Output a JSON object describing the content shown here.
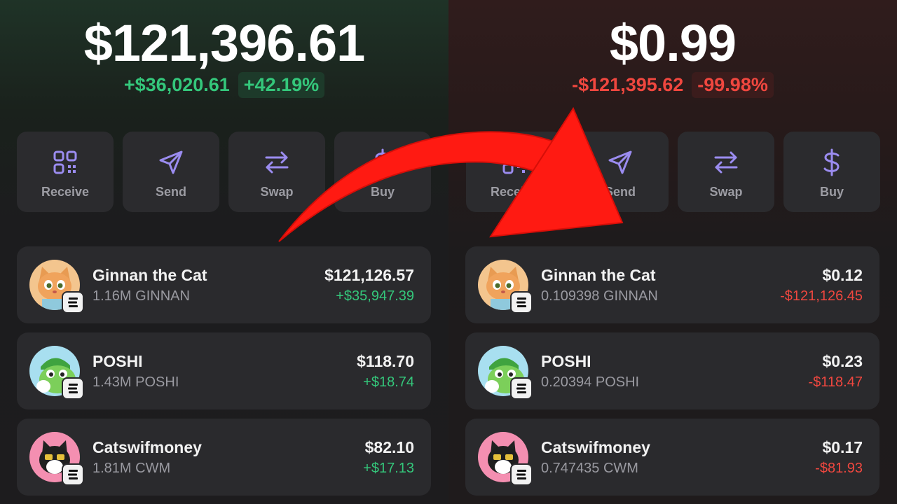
{
  "left": {
    "balance": "$121,396.61",
    "change_amount": "+$36,020.61",
    "change_percent": "+42.19%",
    "actions": [
      {
        "label": "Receive",
        "icon": "qr-code-icon"
      },
      {
        "label": "Send",
        "icon": "send-icon"
      },
      {
        "label": "Swap",
        "icon": "swap-icon"
      },
      {
        "label": "Buy",
        "icon": "dollar-icon"
      }
    ],
    "tokens": [
      {
        "name": "Ginnan the Cat",
        "quantity": "1.16M GINNAN",
        "value": "$121,126.57",
        "change": "+$35,947.39",
        "avatar": "ginnan-cat-avatar"
      },
      {
        "name": "POSHI",
        "quantity": "1.43M POSHI",
        "value": "$118.70",
        "change": "+$18.74",
        "avatar": "poshi-frog-avatar"
      },
      {
        "name": "Catswifmoney",
        "quantity": "1.81M CWM",
        "value": "$82.10",
        "change": "+$17.13",
        "avatar": "catswifmoney-avatar"
      }
    ]
  },
  "right": {
    "balance": "$0.99",
    "change_amount": "-$121,395.62",
    "change_percent": "-99.98%",
    "actions": [
      {
        "label": "Receive",
        "icon": "qr-code-icon"
      },
      {
        "label": "Send",
        "icon": "send-icon"
      },
      {
        "label": "Swap",
        "icon": "swap-icon"
      },
      {
        "label": "Buy",
        "icon": "dollar-icon"
      }
    ],
    "tokens": [
      {
        "name": "Ginnan the Cat",
        "quantity": "0.109398 GINNAN",
        "value": "$0.12",
        "change": "-$121,126.45",
        "avatar": "ginnan-cat-avatar"
      },
      {
        "name": "POSHI",
        "quantity": "0.20394 POSHI",
        "value": "$0.23",
        "change": "-$118.47",
        "avatar": "poshi-frog-avatar"
      },
      {
        "name": "Catswifmoney",
        "quantity": "0.747435 CWM",
        "value": "$0.17",
        "change": "-$81.93",
        "avatar": "catswifmoney-avatar"
      }
    ]
  },
  "colors": {
    "gain": "#34c77b",
    "loss": "#f0473f",
    "accent_icon": "#9b8cf0",
    "arrow": "#ff1a12",
    "card": "#2a2a2d"
  }
}
